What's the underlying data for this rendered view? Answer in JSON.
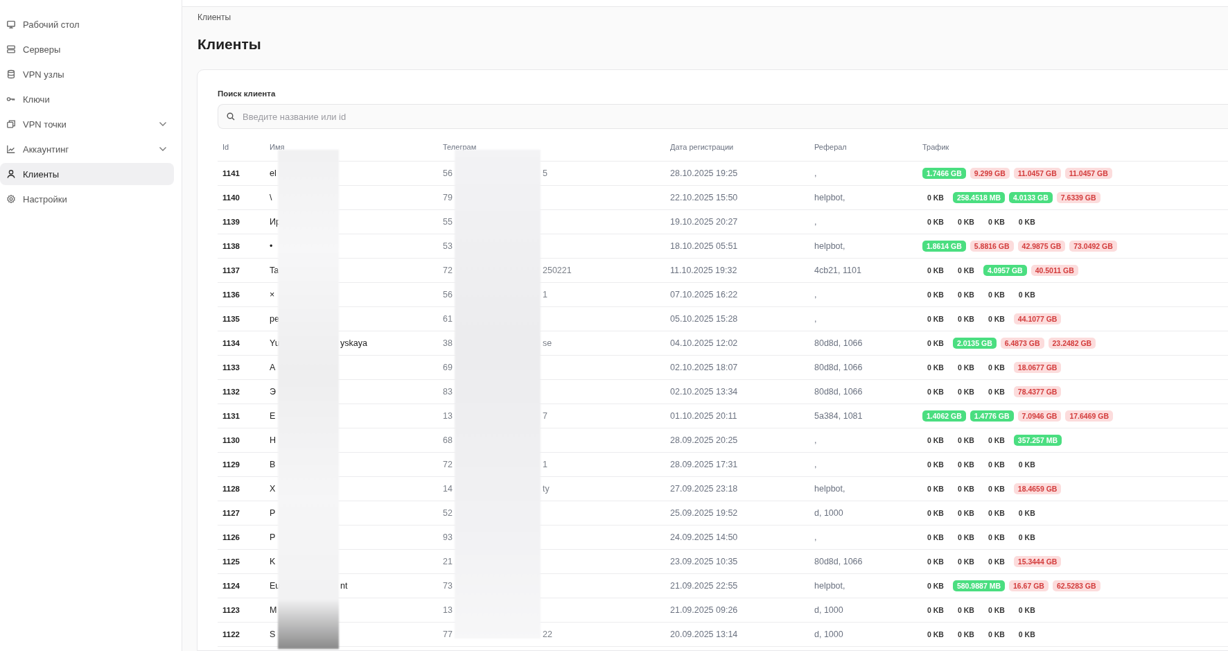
{
  "sidebar": {
    "items": [
      {
        "label": "Рабочий стол",
        "expandable": false,
        "selected": false
      },
      {
        "label": "Серверы",
        "expandable": false,
        "selected": false
      },
      {
        "label": "VPN узлы",
        "expandable": false,
        "selected": false
      },
      {
        "label": "Ключи",
        "expandable": false,
        "selected": false
      },
      {
        "label": "VPN точки",
        "expandable": true,
        "selected": false
      },
      {
        "label": "Аккаунтинг",
        "expandable": true,
        "selected": false
      },
      {
        "label": "Клиенты",
        "expandable": false,
        "selected": true
      },
      {
        "label": "Настройки",
        "expandable": false,
        "selected": false
      }
    ]
  },
  "breadcrumb": "Клиенты",
  "title": "Клиенты",
  "search": {
    "label": "Поиск клиента",
    "placeholder": "Введите название или id"
  },
  "table": {
    "columns": [
      "Id",
      "Имя",
      "Телеграм",
      "Дата регистрации",
      "Реферал",
      "Трафик"
    ],
    "rows": [
      {
        "id": "1141",
        "name_start": "el",
        "telegram_start": "56",
        "telegram_end": "5",
        "date": "28.10.2025 19:25",
        "referral": ",",
        "traffic": [
          {
            "value": "1.7466 GB",
            "kind": "green"
          },
          {
            "value": "9.299 GB",
            "kind": "red"
          },
          {
            "value": "11.0457 GB",
            "kind": "red"
          },
          {
            "value": "11.0457 GB",
            "kind": "red"
          }
        ]
      },
      {
        "id": "1140",
        "name_start": "\\",
        "telegram_start": "79",
        "date": "22.10.2025 15:50",
        "referral": "helpbot,",
        "traffic": [
          {
            "value": "0 KB",
            "kind": "plain"
          },
          {
            "value": "258.4518 MB",
            "kind": "green"
          },
          {
            "value": "4.0133 GB",
            "kind": "green"
          },
          {
            "value": "7.6339 GB",
            "kind": "red"
          }
        ]
      },
      {
        "id": "1139",
        "name_start": "Ир",
        "telegram_start": "55",
        "date": "19.10.2025 20:27",
        "referral": ",",
        "traffic": [
          {
            "value": "0 KB",
            "kind": "plain"
          },
          {
            "value": "0 KB",
            "kind": "plain"
          },
          {
            "value": "0 KB",
            "kind": "plain"
          },
          {
            "value": "0 KB",
            "kind": "plain"
          }
        ]
      },
      {
        "id": "1138",
        "name_start": "•",
        "telegram_start": "53",
        "date": "18.10.2025 05:51",
        "referral": "helpbot,",
        "traffic": [
          {
            "value": "1.8614 GB",
            "kind": "green"
          },
          {
            "value": "5.8816 GB",
            "kind": "red"
          },
          {
            "value": "42.9875 GB",
            "kind": "red"
          },
          {
            "value": "73.0492 GB",
            "kind": "red"
          }
        ]
      },
      {
        "id": "1137",
        "name_start": "Ta",
        "telegram_start": "72",
        "telegram_end": "250221",
        "date": "11.10.2025 19:32",
        "referral": "4cb21, 1101",
        "traffic": [
          {
            "value": "0 KB",
            "kind": "plain"
          },
          {
            "value": "0 KB",
            "kind": "plain"
          },
          {
            "value": "4.0957 GB",
            "kind": "green"
          },
          {
            "value": "40.5011 GB",
            "kind": "red"
          }
        ]
      },
      {
        "id": "1136",
        "name_start": "×",
        "telegram_start": "56",
        "telegram_end": "1",
        "date": "07.10.2025 16:22",
        "referral": ",",
        "traffic": [
          {
            "value": "0 KB",
            "kind": "plain"
          },
          {
            "value": "0 KB",
            "kind": "plain"
          },
          {
            "value": "0 KB",
            "kind": "plain"
          },
          {
            "value": "0 KB",
            "kind": "plain"
          }
        ]
      },
      {
        "id": "1135",
        "name_start": "pe",
        "telegram_start": "61",
        "date": "05.10.2025 15:28",
        "referral": ",",
        "traffic": [
          {
            "value": "0 KB",
            "kind": "plain"
          },
          {
            "value": "0 KB",
            "kind": "plain"
          },
          {
            "value": "0 KB",
            "kind": "plain"
          },
          {
            "value": "44.1077 GB",
            "kind": "red"
          }
        ]
      },
      {
        "id": "1134",
        "name_start": "Yu",
        "name_end": "yskaya",
        "telegram_start": "38",
        "telegram_end": "se",
        "date": "04.10.2025 12:02",
        "referral": "80d8d, 1066",
        "traffic": [
          {
            "value": "0 KB",
            "kind": "plain"
          },
          {
            "value": "2.0135 GB",
            "kind": "green"
          },
          {
            "value": "6.4873 GB",
            "kind": "red"
          },
          {
            "value": "23.2482 GB",
            "kind": "red"
          }
        ]
      },
      {
        "id": "1133",
        "name_start": "А",
        "telegram_start": "69",
        "date": "02.10.2025 18:07",
        "referral": "80d8d, 1066",
        "traffic": [
          {
            "value": "0 KB",
            "kind": "plain"
          },
          {
            "value": "0 KB",
            "kind": "plain"
          },
          {
            "value": "0 KB",
            "kind": "plain"
          },
          {
            "value": "18.0677 GB",
            "kind": "red"
          }
        ]
      },
      {
        "id": "1132",
        "name_start": "Э",
        "telegram_start": "83",
        "date": "02.10.2025 13:34",
        "referral": "80d8d, 1066",
        "traffic": [
          {
            "value": "0 KB",
            "kind": "plain"
          },
          {
            "value": "0 KB",
            "kind": "plain"
          },
          {
            "value": "0 KB",
            "kind": "plain"
          },
          {
            "value": "78.4377 GB",
            "kind": "red"
          }
        ]
      },
      {
        "id": "1131",
        "name_start": "Е",
        "telegram_start": "13",
        "telegram_end": "7",
        "date": "01.10.2025 20:11",
        "referral": "5a384, 1081",
        "traffic": [
          {
            "value": "1.4062 GB",
            "kind": "green"
          },
          {
            "value": "1.4776 GB",
            "kind": "green"
          },
          {
            "value": "7.0946 GB",
            "kind": "red"
          },
          {
            "value": "17.6469 GB",
            "kind": "red"
          }
        ]
      },
      {
        "id": "1130",
        "name_start": "H",
        "telegram_start": "68",
        "date": "28.09.2025 20:25",
        "referral": ",",
        "traffic": [
          {
            "value": "0 KB",
            "kind": "plain"
          },
          {
            "value": "0 KB",
            "kind": "plain"
          },
          {
            "value": "0 KB",
            "kind": "plain"
          },
          {
            "value": "357.257 MB",
            "kind": "green"
          }
        ]
      },
      {
        "id": "1129",
        "name_start": "B",
        "telegram_start": "72",
        "telegram_end": "1",
        "date": "28.09.2025 17:31",
        "referral": ",",
        "traffic": [
          {
            "value": "0 KB",
            "kind": "plain"
          },
          {
            "value": "0 KB",
            "kind": "plain"
          },
          {
            "value": "0 KB",
            "kind": "plain"
          },
          {
            "value": "0 KB",
            "kind": "plain"
          }
        ]
      },
      {
        "id": "1128",
        "name_start": "X",
        "telegram_start": "14",
        "telegram_end": "ty",
        "date": "27.09.2025 23:18",
        "referral": "helpbot,",
        "traffic": [
          {
            "value": "0 KB",
            "kind": "plain"
          },
          {
            "value": "0 KB",
            "kind": "plain"
          },
          {
            "value": "0 KB",
            "kind": "plain"
          },
          {
            "value": "18.4659 GB",
            "kind": "red"
          }
        ]
      },
      {
        "id": "1127",
        "name_start": "P",
        "telegram_start": "52",
        "date": "25.09.2025 19:52",
        "referral": "d, 1000",
        "traffic": [
          {
            "value": "0 KB",
            "kind": "plain"
          },
          {
            "value": "0 KB",
            "kind": "plain"
          },
          {
            "value": "0 KB",
            "kind": "plain"
          },
          {
            "value": "0 KB",
            "kind": "plain"
          }
        ]
      },
      {
        "id": "1126",
        "name_start": "P",
        "telegram_start": "93",
        "date": "24.09.2025 14:50",
        "referral": ",",
        "traffic": [
          {
            "value": "0 KB",
            "kind": "plain"
          },
          {
            "value": "0 KB",
            "kind": "plain"
          },
          {
            "value": "0 KB",
            "kind": "plain"
          },
          {
            "value": "0 KB",
            "kind": "plain"
          }
        ]
      },
      {
        "id": "1125",
        "name_start": "K",
        "telegram_start": "21",
        "date": "23.09.2025 10:35",
        "referral": "80d8d, 1066",
        "traffic": [
          {
            "value": "0 KB",
            "kind": "plain"
          },
          {
            "value": "0 KB",
            "kind": "plain"
          },
          {
            "value": "0 KB",
            "kind": "plain"
          },
          {
            "value": "15.3444 GB",
            "kind": "red"
          }
        ]
      },
      {
        "id": "1124",
        "name_start": "Eu",
        "name_end": "nt",
        "telegram_start": "73",
        "date": "21.09.2025 22:55",
        "referral": "helpbot,",
        "traffic": [
          {
            "value": "0 KB",
            "kind": "plain"
          },
          {
            "value": "580.9887 MB",
            "kind": "green"
          },
          {
            "value": "16.67 GB",
            "kind": "red"
          },
          {
            "value": "62.5283 GB",
            "kind": "red"
          }
        ]
      },
      {
        "id": "1123",
        "name_start": "M",
        "telegram_start": "13",
        "date": "21.09.2025 09:26",
        "referral": "d, 1000",
        "traffic": [
          {
            "value": "0 KB",
            "kind": "plain"
          },
          {
            "value": "0 KB",
            "kind": "plain"
          },
          {
            "value": "0 KB",
            "kind": "plain"
          },
          {
            "value": "0 KB",
            "kind": "plain"
          }
        ]
      },
      {
        "id": "1122",
        "name_start": "S",
        "telegram_start": "77",
        "telegram_end": "22",
        "date": "20.09.2025 13:14",
        "referral": "d, 1000",
        "traffic": [
          {
            "value": "0 KB",
            "kind": "plain"
          },
          {
            "value": "0 KB",
            "kind": "plain"
          },
          {
            "value": "0 KB",
            "kind": "plain"
          },
          {
            "value": "0 KB",
            "kind": "plain"
          }
        ]
      }
    ]
  }
}
